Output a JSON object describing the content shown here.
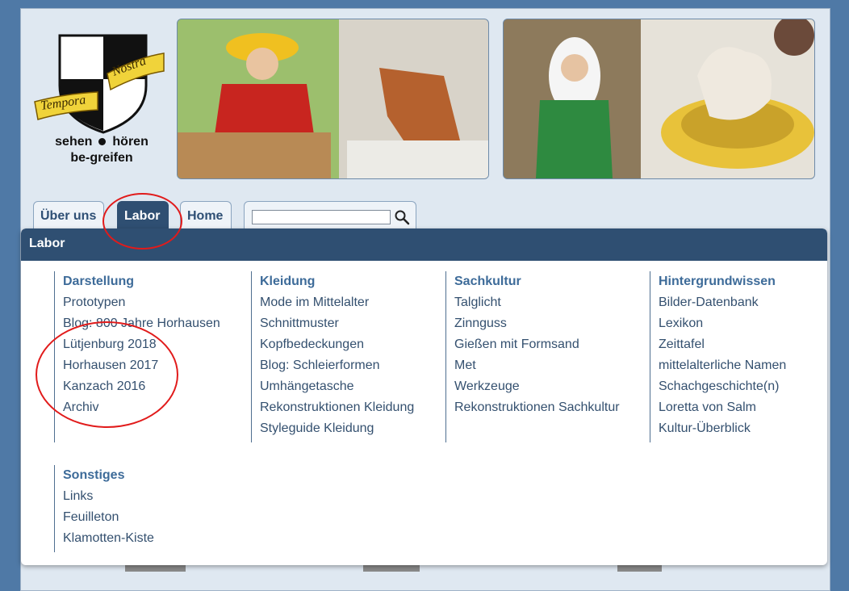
{
  "header": {
    "logo_text": [
      "Tempora",
      "Nostra"
    ],
    "tagline_line1_a": "sehen",
    "tagline_line1_b": "hören",
    "tagline_line2": "be-greifen"
  },
  "tabs": [
    {
      "label": "Über uns"
    },
    {
      "label": "Labor"
    },
    {
      "label": "Home"
    }
  ],
  "search": {
    "placeholder": "",
    "value": ""
  },
  "menu": {
    "title": "Labor",
    "columns": [
      {
        "heading": "Darstellung",
        "items": [
          "Prototypen",
          "Blog: 800 Jahre Horhausen",
          "Lütjenburg 2018",
          "Horhausen 2017",
          "Kanzach 2016",
          "Archiv"
        ]
      },
      {
        "heading": "Kleidung",
        "items": [
          "Mode im Mittelalter",
          "Schnittmuster",
          "Kopfbedeckungen",
          "Blog: Schleierformen",
          "Umhängetasche",
          "Rekonstruktionen Kleidung",
          "Styleguide Kleidung"
        ]
      },
      {
        "heading": "Sachkultur",
        "items": [
          "Talglicht",
          "Zinnguss",
          "Gießen mit Formsand",
          "Met",
          "Werkzeuge",
          "Rekonstruktionen Sachkultur"
        ]
      },
      {
        "heading": "Hintergrundwissen",
        "items": [
          "Bilder-Datenbank",
          "Lexikon",
          "Zeittafel",
          "mittelalterliche Namen",
          "Schachgeschichte(n)",
          "Loretta von Salm",
          "Kultur-Überblick"
        ]
      },
      {
        "heading": "Sonstiges",
        "items": [
          "Links",
          "Feuilleton",
          "Klamotten-Kiste"
        ]
      }
    ]
  },
  "colors": {
    "nav_dark": "#2f4f72",
    "link": "#34506f",
    "heading": "#3d6b99",
    "annotation": "#e11b1b"
  }
}
